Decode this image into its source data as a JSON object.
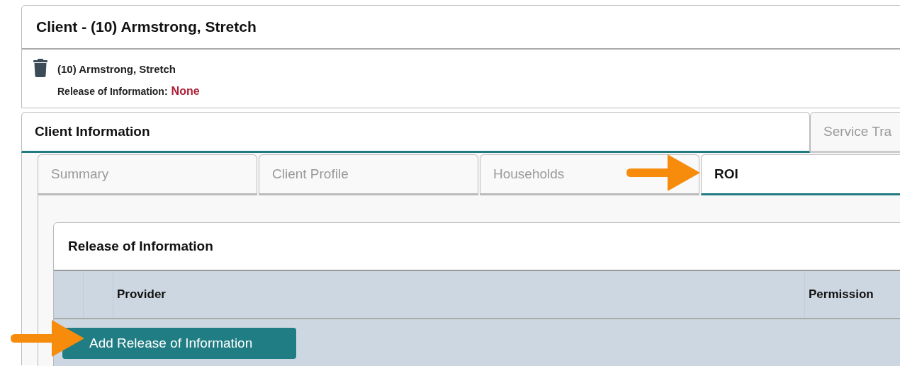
{
  "header": {
    "title": "Client - (10) Armstrong, Stretch"
  },
  "client": {
    "name": "(10) Armstrong, Stretch",
    "roi_label": "Release of Information:",
    "roi_value": "None"
  },
  "main_tabs": [
    {
      "label": "Client Information",
      "selected": true
    },
    {
      "label": "Service Tra",
      "selected": false
    }
  ],
  "sub_tabs": [
    {
      "label": "Summary",
      "selected": false
    },
    {
      "label": "Client Profile",
      "selected": false
    },
    {
      "label": "Households",
      "selected": false
    },
    {
      "label": "ROI",
      "selected": true
    }
  ],
  "roi_panel": {
    "title": "Release of Information",
    "table": {
      "columns": [
        {
          "label": "Provider"
        },
        {
          "label": "Permission"
        }
      ]
    },
    "add_button": "Add Release of Information"
  }
}
